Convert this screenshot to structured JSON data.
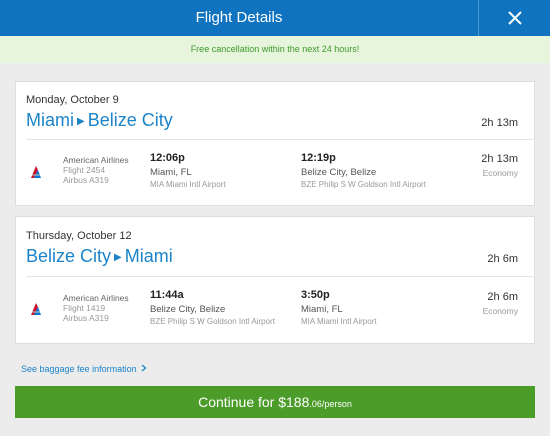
{
  "header": {
    "title": "Flight Details"
  },
  "banner": {
    "text": "Free cancellation within the next 24 hours!"
  },
  "trips": [
    {
      "date": "Monday, October 9",
      "origin": "Miami",
      "destination": "Belize City",
      "duration": "2h 13m",
      "airline": "American Airlines",
      "flight": "Flight 2454",
      "aircraft": "Airbus A319",
      "depart_time": "12:06p",
      "depart_city": "Miami, FL",
      "depart_airport": "MIA Miami Intl Airport",
      "arrive_time": "12:19p",
      "arrive_city": "Belize City, Belize",
      "arrive_airport": "BZE Philip S W Goldson Intl Airport",
      "segment_duration": "2h 13m",
      "cabin": "Economy"
    },
    {
      "date": "Thursday, October 12",
      "origin": "Belize City",
      "destination": "Miami",
      "duration": "2h 6m",
      "airline": "American Airlines",
      "flight": "Flight 1419",
      "aircraft": "Airbus A319",
      "depart_time": "11:44a",
      "depart_city": "Belize City, Belize",
      "depart_airport": "BZE Philip S W Goldson Intl Airport",
      "arrive_time": "3:50p",
      "arrive_city": "Miami, FL",
      "arrive_airport": "MIA Miami Intl Airport",
      "segment_duration": "2h 6m",
      "cabin": "Economy"
    }
  ],
  "baggage_link": "See baggage fee information",
  "continue_button": {
    "label": "Continue for $188",
    "cents": ".06/person"
  },
  "colors": {
    "header": "#0f73bf",
    "link": "#1b84c9",
    "button": "#4c9c2a",
    "banner_bg": "#e6f5dc",
    "banner_text": "#3f9a2b"
  },
  "icons": {
    "close": "close-icon",
    "airline_logo": "american-airlines-logo-icon",
    "route_arrow": "triangle-right-icon",
    "chevron": "chevron-right-icon"
  }
}
